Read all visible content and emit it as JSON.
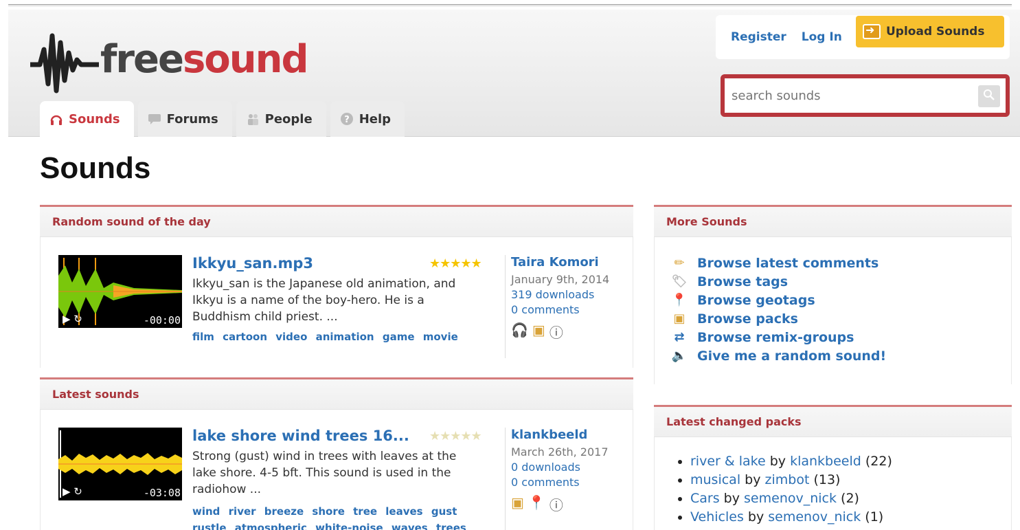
{
  "logo": {
    "free": "free",
    "sound": "sound"
  },
  "tabs": [
    {
      "label": "Sounds",
      "icon": "headphones-icon",
      "active": true
    },
    {
      "label": "Forums",
      "icon": "speech-bubble-icon",
      "active": false
    },
    {
      "label": "People",
      "icon": "people-icon",
      "active": false
    },
    {
      "label": "Help",
      "icon": "help-icon",
      "active": false
    }
  ],
  "account": {
    "register": "Register",
    "login": "Log In",
    "upload": "Upload Sounds"
  },
  "search": {
    "placeholder": "search sounds"
  },
  "page": {
    "title": "Sounds"
  },
  "random_box": {
    "heading": "Random sound of the day",
    "sound": {
      "title": "Ikkyu_san.mp3",
      "stars": "★★★★★",
      "description": "Ikkyu_san is the Japanese old animation, and Ikkyu is a name of the boy-hero. He is a Buddhism child priest. ...",
      "tags": [
        "film",
        "cartoon",
        "video",
        "animation",
        "game",
        "movie"
      ],
      "user": "Taira Komori",
      "date": "January 9th, 2014",
      "downloads": "319 downloads",
      "comments": "0 comments",
      "time": "-00:00"
    }
  },
  "latest_box": {
    "heading": "Latest sounds",
    "sound": {
      "title": "lake shore wind trees 16...",
      "stars": "★★★★★",
      "description": "Strong (gust) wind in trees with leaves at the lake shore. 4-5 bft. This sound is used in the radiohow ...",
      "tags": [
        "wind",
        "river",
        "breeze",
        "shore",
        "tree",
        "leaves",
        "gust",
        "rustle",
        "atmospheric",
        "white-noise",
        "waves",
        "trees"
      ],
      "user": "klankbeeld",
      "date": "March 26th, 2017",
      "downloads": "0 downloads",
      "comments": "0 comments",
      "time": "-03:08"
    }
  },
  "more_box": {
    "heading": "More Sounds",
    "items": [
      {
        "label": "Browse latest comments",
        "icon": "pencil-icon"
      },
      {
        "label": "Browse tags",
        "icon": "tag-icon"
      },
      {
        "label": "Browse geotags",
        "icon": "map-pin-icon"
      },
      {
        "label": "Browse packs",
        "icon": "pack-icon"
      },
      {
        "label": "Browse remix-groups",
        "icon": "remix-icon"
      },
      {
        "label": "Give me a random sound!",
        "icon": "speaker-icon"
      }
    ]
  },
  "packs_box": {
    "heading": "Latest changed packs",
    "packs": [
      {
        "name": "river & lake",
        "by": "by",
        "user": "klankbeeld",
        "count": "(22)"
      },
      {
        "name": "musical",
        "by": "by",
        "user": "zimbot",
        "count": "(13)"
      },
      {
        "name": "Cars",
        "by": "by",
        "user": "semenov_nick",
        "count": "(2)"
      },
      {
        "name": "Vehicles",
        "by": "by",
        "user": "semenov_nick",
        "count": "(1)"
      }
    ]
  },
  "colors": {
    "brand_red": "#c9373e",
    "link_blue": "#2b6fb4",
    "upload_yellow": "#f7c02e"
  }
}
